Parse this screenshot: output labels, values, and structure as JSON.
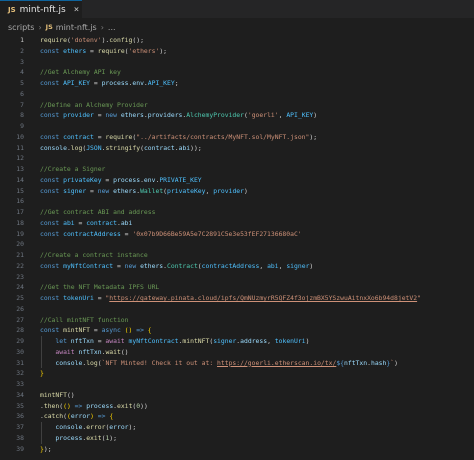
{
  "tab": {
    "lang_badge": "JS",
    "filename": "mint-nft.js",
    "close": "×"
  },
  "breadcrumb": {
    "folder": "scripts",
    "file_badge": "JS",
    "file": "mint-nft.js",
    "more": "..."
  },
  "lines": [
    {
      "n": "1",
      "segs": [
        [
          "f",
          "require"
        ],
        [
          "p",
          "("
        ],
        [
          "s",
          "'dotenv'"
        ],
        [
          "p",
          ")."
        ],
        [
          "f",
          "config"
        ],
        [
          "p",
          "();"
        ]
      ]
    },
    {
      "n": "2",
      "segs": [
        [
          "k",
          "const "
        ],
        [
          "c2",
          "ethers"
        ],
        [
          "p",
          " = "
        ],
        [
          "f",
          "require"
        ],
        [
          "p",
          "("
        ],
        [
          "s",
          "'ethers'"
        ],
        [
          "p",
          ");"
        ]
      ]
    },
    {
      "n": "3",
      "segs": []
    },
    {
      "n": "4",
      "segs": [
        [
          "cm",
          "//Get Alchemy API key"
        ]
      ]
    },
    {
      "n": "5",
      "segs": [
        [
          "k",
          "const "
        ],
        [
          "c2",
          "API_KEY"
        ],
        [
          "p",
          " = "
        ],
        [
          "v",
          "process"
        ],
        [
          "p",
          "."
        ],
        [
          "v",
          "env"
        ],
        [
          "p",
          "."
        ],
        [
          "c2",
          "API_KEY"
        ],
        [
          "p",
          ";"
        ]
      ]
    },
    {
      "n": "6",
      "segs": []
    },
    {
      "n": "7",
      "segs": [
        [
          "cm",
          "//Define an Alchemy Provider"
        ]
      ]
    },
    {
      "n": "8",
      "segs": [
        [
          "k",
          "const "
        ],
        [
          "c2",
          "provider"
        ],
        [
          "p",
          " = "
        ],
        [
          "k",
          "new "
        ],
        [
          "v",
          "ethers"
        ],
        [
          "p",
          "."
        ],
        [
          "v",
          "providers"
        ],
        [
          "p",
          "."
        ],
        [
          "t",
          "AlchemyProvider"
        ],
        [
          "p",
          "("
        ],
        [
          "s",
          "'goerli'"
        ],
        [
          "p",
          ", "
        ],
        [
          "c2",
          "API_KEY"
        ],
        [
          "p",
          ")"
        ]
      ]
    },
    {
      "n": "9",
      "segs": []
    },
    {
      "n": "10",
      "segs": [
        [
          "k",
          "const "
        ],
        [
          "c2",
          "contract"
        ],
        [
          "p",
          " = "
        ],
        [
          "f",
          "require"
        ],
        [
          "p",
          "("
        ],
        [
          "s",
          "\"../artifacts/contracts/MyNFT.sol/MyNFT.json\""
        ],
        [
          "p",
          ");"
        ]
      ]
    },
    {
      "n": "11",
      "segs": [
        [
          "v",
          "console"
        ],
        [
          "p",
          "."
        ],
        [
          "f",
          "log"
        ],
        [
          "p",
          "("
        ],
        [
          "c2",
          "JSON"
        ],
        [
          "p",
          "."
        ],
        [
          "f",
          "stringify"
        ],
        [
          "p",
          "("
        ],
        [
          "v",
          "contract"
        ],
        [
          "p",
          "."
        ],
        [
          "v",
          "abi"
        ],
        [
          "p",
          "));"
        ]
      ]
    },
    {
      "n": "12",
      "segs": []
    },
    {
      "n": "13",
      "segs": [
        [
          "cm",
          "//Create a Signer"
        ]
      ]
    },
    {
      "n": "14",
      "segs": [
        [
          "k",
          "const "
        ],
        [
          "c2",
          "privateKey"
        ],
        [
          "p",
          " = "
        ],
        [
          "v",
          "process"
        ],
        [
          "p",
          "."
        ],
        [
          "v",
          "env"
        ],
        [
          "p",
          "."
        ],
        [
          "c2",
          "PRIVATE_KEY"
        ]
      ]
    },
    {
      "n": "15",
      "segs": [
        [
          "k",
          "const "
        ],
        [
          "c2",
          "signer"
        ],
        [
          "p",
          " = "
        ],
        [
          "k",
          "new "
        ],
        [
          "v",
          "ethers"
        ],
        [
          "p",
          "."
        ],
        [
          "t",
          "Wallet"
        ],
        [
          "p",
          "("
        ],
        [
          "c2",
          "privateKey"
        ],
        [
          "p",
          ", "
        ],
        [
          "c2",
          "provider"
        ],
        [
          "p",
          ")"
        ]
      ]
    },
    {
      "n": "16",
      "segs": []
    },
    {
      "n": "17",
      "segs": [
        [
          "cm",
          "//Get contract ABI and address"
        ]
      ]
    },
    {
      "n": "18",
      "segs": [
        [
          "k",
          "const "
        ],
        [
          "c2",
          "abi"
        ],
        [
          "p",
          " = "
        ],
        [
          "c2",
          "contract"
        ],
        [
          "p",
          "."
        ],
        [
          "v",
          "abi"
        ]
      ]
    },
    {
      "n": "19",
      "segs": [
        [
          "k",
          "const "
        ],
        [
          "c2",
          "contractAddress"
        ],
        [
          "p",
          " = "
        ],
        [
          "s",
          "'0x07b9D66Be59A5e7C2891C5e3e53fEF27136680aC'"
        ]
      ]
    },
    {
      "n": "20",
      "segs": []
    },
    {
      "n": "21",
      "segs": [
        [
          "cm",
          "//Create a contract instance"
        ]
      ]
    },
    {
      "n": "22",
      "segs": [
        [
          "k",
          "const "
        ],
        [
          "c2",
          "myNftContract"
        ],
        [
          "p",
          " = "
        ],
        [
          "k",
          "new "
        ],
        [
          "v",
          "ethers"
        ],
        [
          "p",
          "."
        ],
        [
          "t",
          "Contract"
        ],
        [
          "p",
          "("
        ],
        [
          "c2",
          "contractAddress"
        ],
        [
          "p",
          ", "
        ],
        [
          "c2",
          "abi"
        ],
        [
          "p",
          ", "
        ],
        [
          "c2",
          "signer"
        ],
        [
          "p",
          ")"
        ]
      ]
    },
    {
      "n": "23",
      "segs": []
    },
    {
      "n": "24",
      "segs": [
        [
          "cm",
          "//Get the NFT Metadata IPFS URL"
        ]
      ]
    },
    {
      "n": "25",
      "segs": [
        [
          "k",
          "const "
        ],
        [
          "c2",
          "tokenUri"
        ],
        [
          "p",
          " = "
        ],
        [
          "s",
          "\""
        ],
        [
          "su",
          "https://gateway.pinata.cloud/ipfs/QmNUzmyrR5QFZ4f3ojzmBX5YSzwuAitnxXo6b94d8jetV2"
        ],
        [
          "s",
          "\""
        ]
      ]
    },
    {
      "n": "26",
      "segs": []
    },
    {
      "n": "27",
      "segs": [
        [
          "cm",
          "//Call mintNFT function"
        ]
      ]
    },
    {
      "n": "28",
      "segs": [
        [
          "k",
          "const "
        ],
        [
          "f",
          "mintNFT"
        ],
        [
          "p",
          " = "
        ],
        [
          "k",
          "async "
        ],
        [
          "b",
          "()"
        ],
        [
          "p",
          " "
        ],
        [
          "k",
          "=>"
        ],
        [
          "p",
          " "
        ],
        [
          "b",
          "{"
        ]
      ]
    },
    {
      "n": "29",
      "segs": [
        [
          "p",
          "    "
        ],
        [
          "k",
          "let "
        ],
        [
          "v",
          "nftTxn"
        ],
        [
          "p",
          " = "
        ],
        [
          "kw",
          "await "
        ],
        [
          "c2",
          "myNftContract"
        ],
        [
          "p",
          "."
        ],
        [
          "f",
          "mintNFT"
        ],
        [
          "p",
          "("
        ],
        [
          "c2",
          "signer"
        ],
        [
          "p",
          "."
        ],
        [
          "v",
          "address"
        ],
        [
          "p",
          ", "
        ],
        [
          "c2",
          "tokenUri"
        ],
        [
          "p",
          ")"
        ]
      ]
    },
    {
      "n": "30",
      "segs": [
        [
          "p",
          "    "
        ],
        [
          "kw",
          "await "
        ],
        [
          "v",
          "nftTxn"
        ],
        [
          "p",
          "."
        ],
        [
          "f",
          "wait"
        ],
        [
          "p",
          "()"
        ]
      ]
    },
    {
      "n": "31",
      "segs": [
        [
          "p",
          "    "
        ],
        [
          "v",
          "console"
        ],
        [
          "p",
          "."
        ],
        [
          "f",
          "log"
        ],
        [
          "p",
          "("
        ],
        [
          "s",
          "`NFT Minted! Check it out at: "
        ],
        [
          "su",
          "https://goerli.etherscan.io/tx/"
        ],
        [
          "k",
          "${"
        ],
        [
          "v",
          "nftTxn"
        ],
        [
          "p",
          "."
        ],
        [
          "v",
          "hash"
        ],
        [
          "k",
          "}"
        ],
        [
          "s",
          "`"
        ],
        [
          "p",
          ")"
        ]
      ]
    },
    {
      "n": "32",
      "segs": [
        [
          "b",
          "}"
        ]
      ]
    },
    {
      "n": "33",
      "segs": []
    },
    {
      "n": "34",
      "segs": [
        [
          "f",
          "mintNFT"
        ],
        [
          "p",
          "()"
        ]
      ]
    },
    {
      "n": "35",
      "segs": [
        [
          "p",
          "."
        ],
        [
          "f",
          "then"
        ],
        [
          "p",
          "("
        ],
        [
          "b",
          "()"
        ],
        [
          "p",
          " "
        ],
        [
          "k",
          "=>"
        ],
        [
          "p",
          " "
        ],
        [
          "v",
          "process"
        ],
        [
          "p",
          "."
        ],
        [
          "f",
          "exit"
        ],
        [
          "p",
          "("
        ],
        [
          "n",
          "0"
        ],
        [
          "p",
          "))"
        ]
      ]
    },
    {
      "n": "36",
      "segs": [
        [
          "p",
          "."
        ],
        [
          "f",
          "catch"
        ],
        [
          "p",
          "("
        ],
        [
          "b",
          "("
        ],
        [
          "v",
          "error"
        ],
        [
          "b",
          ")"
        ],
        [
          "p",
          " "
        ],
        [
          "k",
          "=>"
        ],
        [
          "p",
          " "
        ],
        [
          "b",
          "{"
        ]
      ]
    },
    {
      "n": "37",
      "segs": [
        [
          "p",
          "    "
        ],
        [
          "v",
          "console"
        ],
        [
          "p",
          "."
        ],
        [
          "f",
          "error"
        ],
        [
          "p",
          "("
        ],
        [
          "v",
          "error"
        ],
        [
          "p",
          ");"
        ]
      ]
    },
    {
      "n": "38",
      "segs": [
        [
          "p",
          "    "
        ],
        [
          "v",
          "process"
        ],
        [
          "p",
          "."
        ],
        [
          "f",
          "exit"
        ],
        [
          "p",
          "("
        ],
        [
          "n",
          "1"
        ],
        [
          "p",
          ");"
        ]
      ]
    },
    {
      "n": "39",
      "segs": [
        [
          "b",
          "}"
        ],
        [
          "p",
          ");"
        ]
      ]
    }
  ]
}
